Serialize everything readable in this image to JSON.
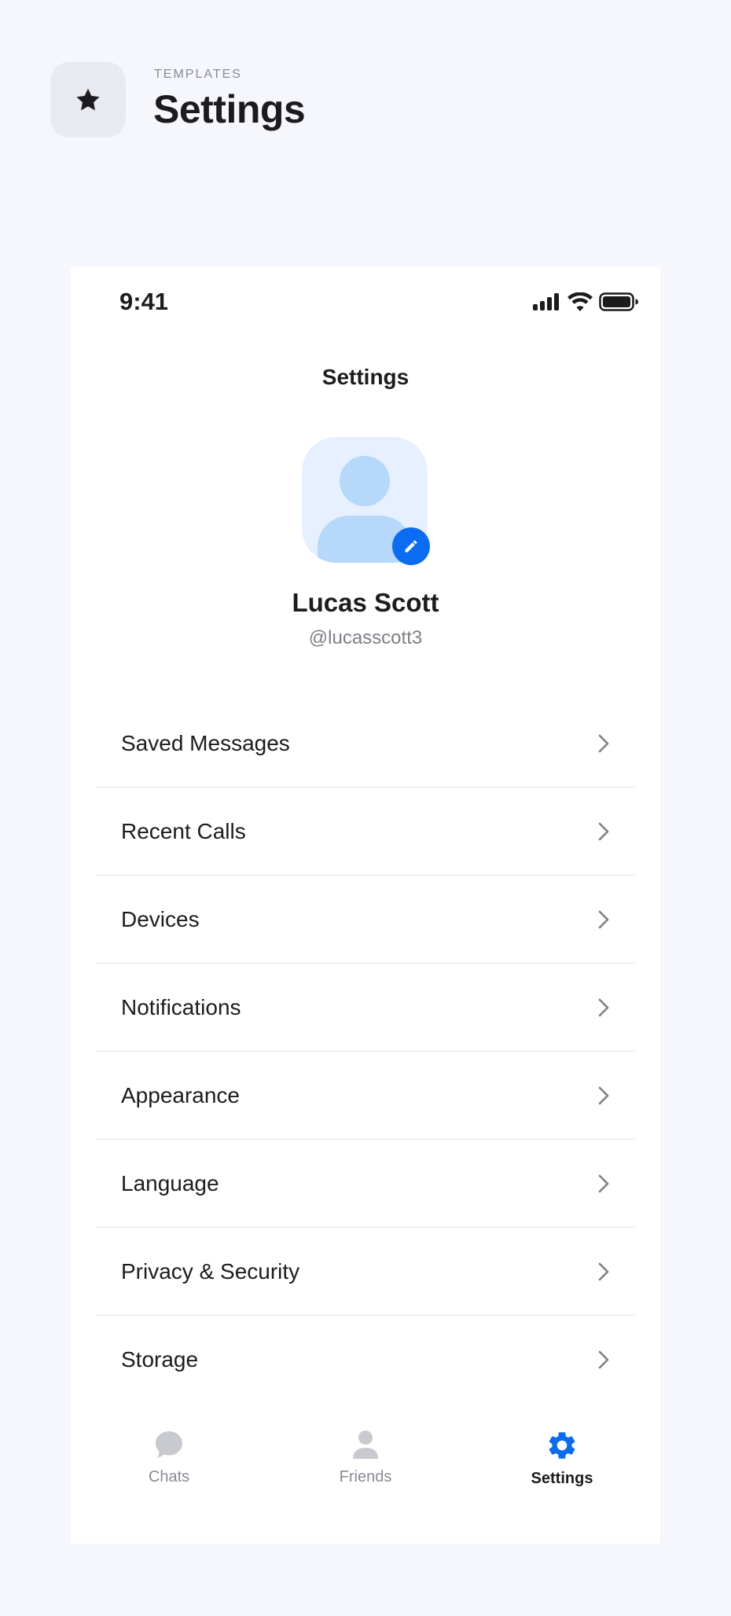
{
  "header": {
    "eyebrow": "TEMPLATES",
    "title": "Settings",
    "badge_icon": "star-icon"
  },
  "status_bar": {
    "time": "9:41",
    "icons": [
      "signal-icon",
      "wifi-icon",
      "battery-icon"
    ]
  },
  "screen": {
    "title": "Settings"
  },
  "profile": {
    "name": "Lucas Scott",
    "handle": "@lucasscott3",
    "avatar_icon": "avatar-placeholder-icon",
    "edit_icon": "pencil-icon"
  },
  "menu": {
    "items": [
      {
        "label": "Saved Messages"
      },
      {
        "label": "Recent Calls"
      },
      {
        "label": "Devices"
      },
      {
        "label": "Notifications"
      },
      {
        "label": "Appearance"
      },
      {
        "label": "Language"
      },
      {
        "label": "Privacy & Security"
      },
      {
        "label": "Storage"
      }
    ]
  },
  "tabbar": {
    "tabs": [
      {
        "label": "Chats",
        "icon": "chat-bubble-icon",
        "active": false
      },
      {
        "label": "Friends",
        "icon": "person-icon",
        "active": false
      },
      {
        "label": "Settings",
        "icon": "gear-icon",
        "active": true
      }
    ]
  },
  "colors": {
    "accent": "#0a6cf0",
    "page_background": "#f6f7fc",
    "avatar_background": "#e6f0ff",
    "avatar_figure": "#b6d8fb",
    "inactive_icon": "#c9cacf"
  }
}
